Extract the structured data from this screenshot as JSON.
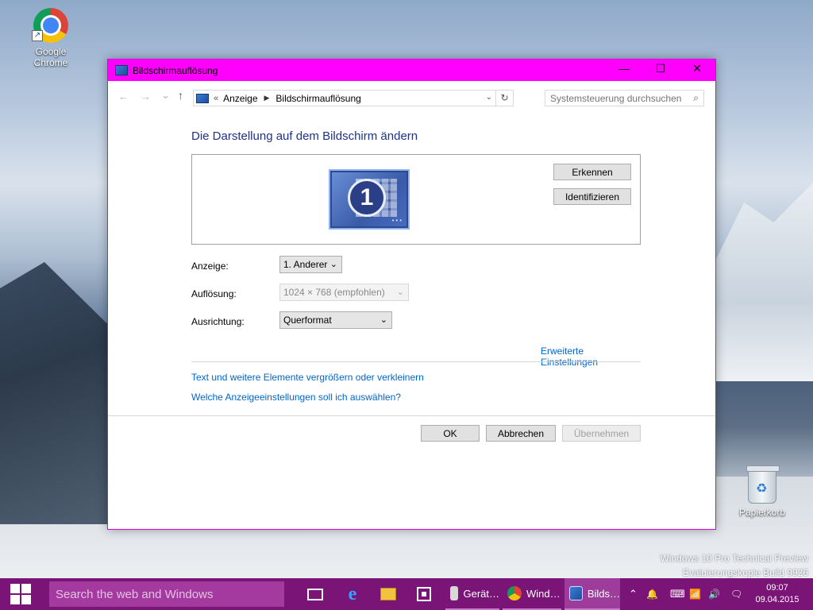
{
  "desktop": {
    "chrome_label": "Google Chrome",
    "recycle_label": "Papierkorb",
    "watermark_line1": "Windows 10 Pro Technical Preview",
    "watermark_line2": "Evaluierungskopie Build 9926"
  },
  "window": {
    "title": "Bildschirmauflösung",
    "controls": {
      "minimize": "—",
      "maximize": "☐",
      "close": "✕"
    }
  },
  "nav": {
    "back": "←",
    "forward": "→",
    "recent": "⌄",
    "up": "↑",
    "overflow": "«",
    "crumbs": [
      "Anzeige",
      "Bildschirmauflösung"
    ],
    "crumb_arrow": "▶",
    "dropdown": "⌄",
    "refresh": "↻",
    "search_placeholder": "Systemsteuerung durchsuchen",
    "search_glass": "⌕"
  },
  "main": {
    "heading": "Die Darstellung auf dem Bildschirm ändern",
    "monitor_number": "1",
    "monitor_dots": "•••",
    "detect_button": "Erkennen",
    "identify_button": "Identifizieren",
    "display_label": "Anzeige:",
    "display_value": "1. Anderer",
    "resolution_label": "Auflösung:",
    "resolution_value": "1024 × 768 (empfohlen)",
    "orientation_label": "Ausrichtung:",
    "orientation_value": "Querformat",
    "chevron": "⌄",
    "advanced_link": "Erweiterte Einstellungen",
    "link_text_size": "Text und weitere Elemente vergrößern oder verkleinern",
    "link_which_settings": "Welche Anzeigeeinstellungen soll ich auswählen?",
    "ok_button": "OK",
    "cancel_button": "Abbrechen",
    "apply_button": "Übernehmen"
  },
  "taskbar": {
    "search_placeholder": "Search the web and Windows",
    "tasks": [
      {
        "label": "Gerät…"
      },
      {
        "label": "Wind…"
      },
      {
        "label": "Bilds…"
      }
    ],
    "tray_chevron": "⌃",
    "tray_notify": "🔔",
    "tray_keyboard": "⌨",
    "tray_network": "📶",
    "tray_volume": "🔊",
    "tray_action": "🗨",
    "clock_time": "09:07",
    "clock_date": "09.04.2015"
  },
  "colors": {
    "titlebar": "#ff00ff",
    "taskbar": "#7a1477",
    "heading": "#1e3287",
    "link": "#0066cc"
  }
}
